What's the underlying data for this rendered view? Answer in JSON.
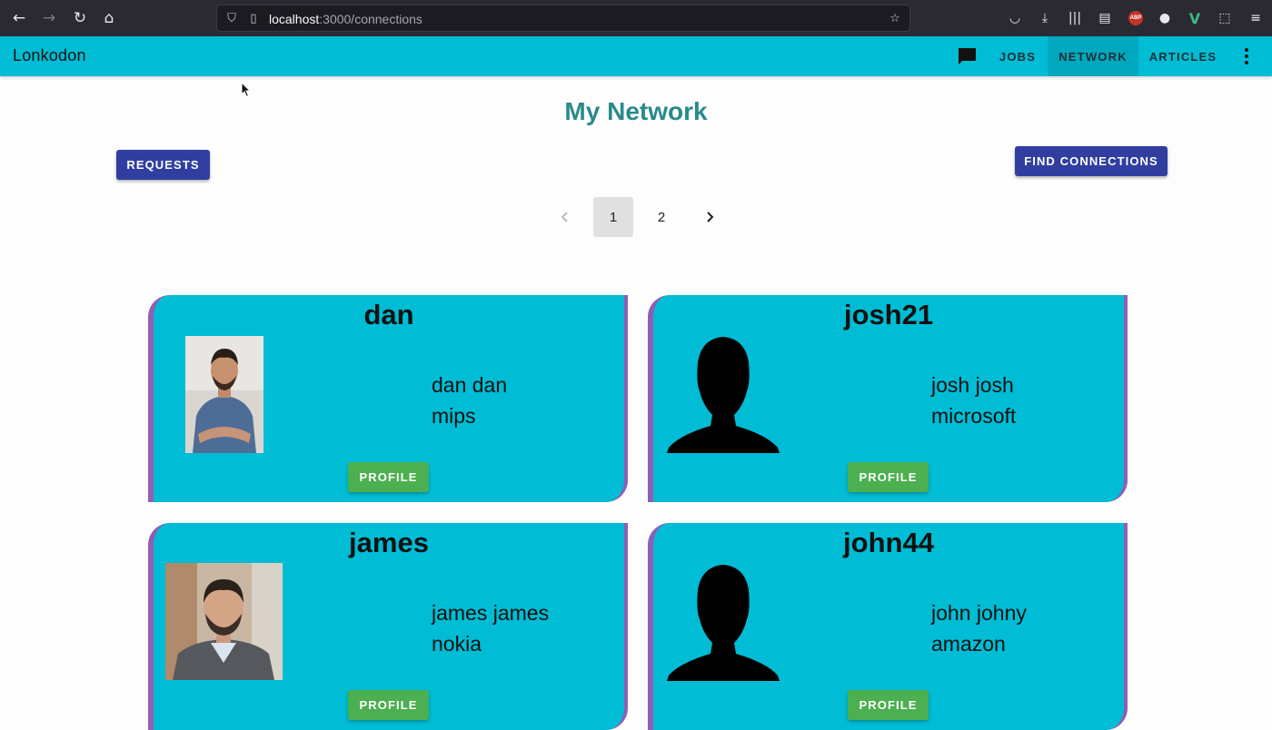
{
  "browser": {
    "url_host": "localhost",
    "url_path": ":3000/connections"
  },
  "app": {
    "brand": "Lonkodon",
    "nav": [
      {
        "label": "JOBS",
        "active": false
      },
      {
        "label": "NETWORK",
        "active": true
      },
      {
        "label": "ARTICLES",
        "active": false
      }
    ]
  },
  "page": {
    "title": "My Network",
    "requests_label": "REQUESTS",
    "find_label": "FIND CONNECTIONS"
  },
  "pagination": {
    "prev_icon": "chevron-left-icon",
    "pages": [
      "1",
      "2"
    ],
    "current": "1",
    "next_icon": "chevron-right-icon"
  },
  "connections": [
    {
      "username": "dan",
      "full_name": "dan dan",
      "company": "mips",
      "photo": "man-blue-shirt-photo",
      "button": "PROFILE"
    },
    {
      "username": "josh21",
      "full_name": "josh josh",
      "company": "microsoft",
      "photo": "default-avatar-silhouette",
      "button": "PROFILE"
    },
    {
      "username": "james",
      "full_name": "james james",
      "company": "nokia",
      "photo": "man-suit-photo",
      "button": "PROFILE"
    },
    {
      "username": "john44",
      "full_name": "john johny",
      "company": "amazon",
      "photo": "default-avatar-silhouette",
      "button": "PROFILE"
    }
  ],
  "colors": {
    "appbar": "#00bcd4",
    "card_border": "#8e5fb5",
    "primary_button": "#303f9f",
    "profile_button": "#4caf50",
    "title": "#2a8a8a"
  }
}
